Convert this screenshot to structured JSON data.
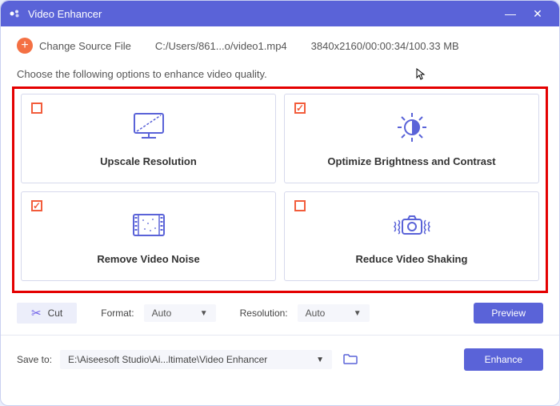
{
  "titlebar": {
    "title": "Video Enhancer"
  },
  "source": {
    "change_label": "Change Source File",
    "path": "C:/Users/861...o/video1.mp4",
    "info": "3840x2160/00:00:34/100.33 MB"
  },
  "instruction": "Choose the following options to enhance video quality.",
  "options": {
    "upscale": {
      "title": "Upscale Resolution",
      "checked": false
    },
    "brightness": {
      "title": "Optimize Brightness and Contrast",
      "checked": true
    },
    "noise": {
      "title": "Remove Video Noise",
      "checked": true
    },
    "shaking": {
      "title": "Reduce Video Shaking",
      "checked": false
    }
  },
  "controls": {
    "cut_label": "Cut",
    "format_label": "Format:",
    "format_value": "Auto",
    "resolution_label": "Resolution:",
    "resolution_value": "Auto",
    "preview_label": "Preview"
  },
  "save": {
    "label": "Save to:",
    "path": "E:\\Aiseesoft Studio\\Ai...ltimate\\Video Enhancer",
    "enhance_label": "Enhance"
  }
}
